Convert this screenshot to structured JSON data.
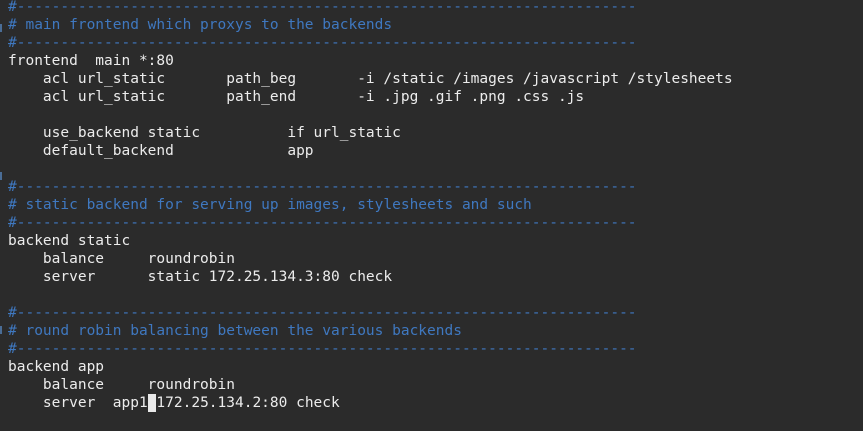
{
  "editor": {
    "lines": [
      {
        "kind": "comment",
        "text": "#-----------------------------------------------------------------------"
      },
      {
        "kind": "comment",
        "text": "# main frontend which proxys to the backends"
      },
      {
        "kind": "comment",
        "text": "#-----------------------------------------------------------------------"
      },
      {
        "kind": "code",
        "text": "frontend  main *:80"
      },
      {
        "kind": "code",
        "text": "    acl url_static       path_beg       -i /static /images /javascript /stylesheets"
      },
      {
        "kind": "code",
        "text": "    acl url_static       path_end       -i .jpg .gif .png .css .js"
      },
      {
        "kind": "code",
        "text": ""
      },
      {
        "kind": "code",
        "text": "    use_backend static          if url_static"
      },
      {
        "kind": "code",
        "text": "    default_backend             app"
      },
      {
        "kind": "code",
        "text": ""
      },
      {
        "kind": "comment",
        "text": "#-----------------------------------------------------------------------"
      },
      {
        "kind": "comment",
        "text": "# static backend for serving up images, stylesheets and such"
      },
      {
        "kind": "comment",
        "text": "#-----------------------------------------------------------------------"
      },
      {
        "kind": "code",
        "text": "backend static"
      },
      {
        "kind": "code",
        "text": "    balance     roundrobin"
      },
      {
        "kind": "code",
        "text": "    server      static 172.25.134.3:80 check"
      },
      {
        "kind": "code",
        "text": ""
      },
      {
        "kind": "comment",
        "text": "#-----------------------------------------------------------------------"
      },
      {
        "kind": "comment",
        "text": "# round robin balancing between the various backends"
      },
      {
        "kind": "comment",
        "text": "#-----------------------------------------------------------------------"
      },
      {
        "kind": "code",
        "text": "backend app"
      },
      {
        "kind": "code",
        "text": "    balance     roundrobin"
      }
    ],
    "cursor_line": {
      "before": "    server  app1",
      "cursor_char": " ",
      "after": "172.25.134.2:80 check"
    }
  },
  "colors": {
    "background": "#2b2b2b",
    "comment": "#3f78c0",
    "text": "#ececec",
    "cursor": "#e9e9e9"
  }
}
